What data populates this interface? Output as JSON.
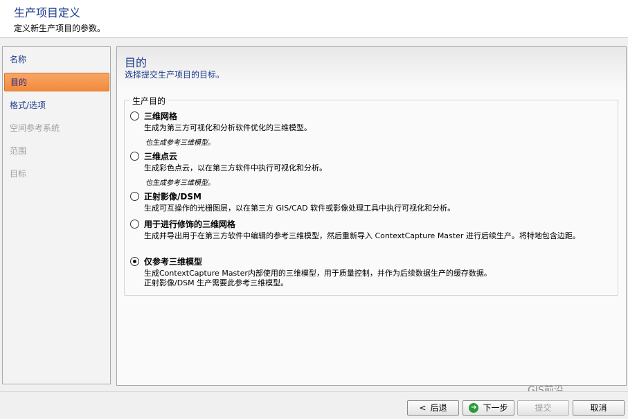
{
  "header": {
    "title": "生产项目定义",
    "subtitle": "定义新生产项目的参数。"
  },
  "sidebar": {
    "items": [
      {
        "label": "名称",
        "state": "normal"
      },
      {
        "label": "目的",
        "state": "active"
      },
      {
        "label": "格式/选项",
        "state": "normal"
      },
      {
        "label": "空间参考系统",
        "state": "disabled"
      },
      {
        "label": "范围",
        "state": "disabled"
      },
      {
        "label": "目标",
        "state": "disabled"
      }
    ]
  },
  "main": {
    "title": "目的",
    "subtitle": "选择提交生产项目的目标。",
    "group_label": "生产目的",
    "options": [
      {
        "label": "三维网格",
        "desc": "生成为第三方可视化和分析软件优化的三维模型。",
        "note": "也生成参考三维模型。",
        "checked": false
      },
      {
        "label": "三维点云",
        "desc": "生成彩色点云，以在第三方软件中执行可视化和分析。",
        "note": "也生成参考三维模型。",
        "checked": false
      },
      {
        "label": "正射影像/DSM",
        "desc": "生成可互操作的光栅图层，以在第三方 GIS/CAD 软件或影像处理工具中执行可视化和分析。",
        "note": "",
        "checked": false
      },
      {
        "label": "用于进行修饰的三维网格",
        "desc": "生成并导出用于在第三方软件中编辑的参考三维模型，然后重新导入 ContextCapture Master 进行后续生产。将特地包含边距。",
        "note": "",
        "checked": false
      },
      {
        "label": "仅参考三维模型",
        "desc": "生成ContextCapture Master内部使用的三维模型，用于质量控制，并作为后续数据生产的缓存数据。\n正射影像/DSM 生产需要此参考三维模型。",
        "note": "",
        "checked": true
      }
    ]
  },
  "footer": {
    "back_label": "后退",
    "back_icon": "<",
    "next_label": "下一步",
    "next_icon": "➔",
    "submit_label": "提交",
    "cancel_label": "取消"
  },
  "watermark": "GIS前沿",
  "colors": {
    "accent": "#f28a3c",
    "title": "#1a3a8a"
  }
}
